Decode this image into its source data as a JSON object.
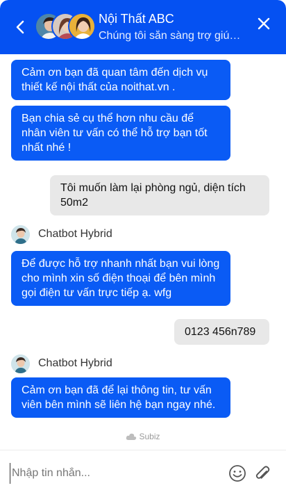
{
  "header": {
    "title": "Nội Thất ABC",
    "subtitle": "Chúng tôi sẵn sàng trợ giú…",
    "back_icon": "chevron-left-icon",
    "close_icon": "close-icon"
  },
  "messages": [
    {
      "from": "bot",
      "text": "Cảm ơn bạn đã quan tâm đến dịch vụ thiết kế nội thất của noithat.vn ."
    },
    {
      "from": "bot",
      "text": "Bạn chia sẻ cụ thể hơn nhu cầu để nhân viên tư vấn có thể hỗ trợ bạn tốt nhất nhé !"
    },
    {
      "from": "user",
      "text": "Tôi muốn làm lại phòng ngủ, diện tích 50m2"
    },
    {
      "from": "bot",
      "sender": "Chatbot Hybrid",
      "text": "Để được hỗ trợ nhanh nhất bạn vui lòng cho mình xin số điện thoại để bên mình gọi điện tư vấn trực tiếp ạ. wfg"
    },
    {
      "from": "user",
      "text": "0123 456n789"
    },
    {
      "from": "bot",
      "sender": "Chatbot Hybrid",
      "text": "Cảm ơn bạn đã để lại thông tin, tư vấn viên bên mình sẽ liên hệ bạn ngay nhé."
    }
  ],
  "powered_by": "Subiz",
  "composer": {
    "placeholder": "Nhập tin nhắn...",
    "value": ""
  },
  "colors": {
    "accent": "#0551f2",
    "bot_bubble": "#0a5bf5",
    "user_bubble": "#e8e8e8"
  }
}
